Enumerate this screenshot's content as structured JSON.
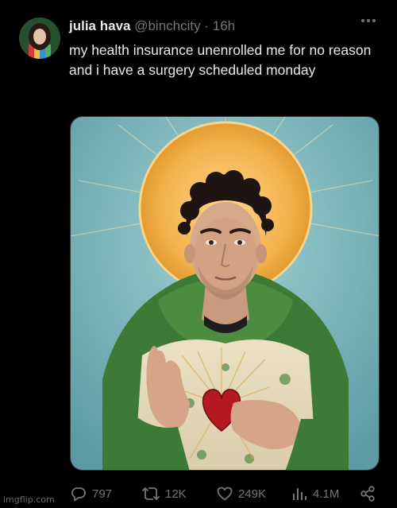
{
  "tweet": {
    "display_name": "julia hava",
    "handle": "@binchcity",
    "separator": "·",
    "time": "16h",
    "text": "my health insurance unenrolled me for no reason and i have a surgery scheduled monday"
  },
  "actions": {
    "replies": "797",
    "reposts": "12K",
    "likes": "249K",
    "views": "4.1M"
  },
  "icons": {
    "more": "more-horizontal-icon",
    "reply": "reply-icon",
    "repost": "repost-icon",
    "like": "heart-icon",
    "views": "views-chart-icon",
    "share": "share-icon"
  },
  "colors": {
    "background": "#000000",
    "text": "#e7e9ea",
    "muted": "#71767b"
  },
  "watermark": "imgflip.com"
}
